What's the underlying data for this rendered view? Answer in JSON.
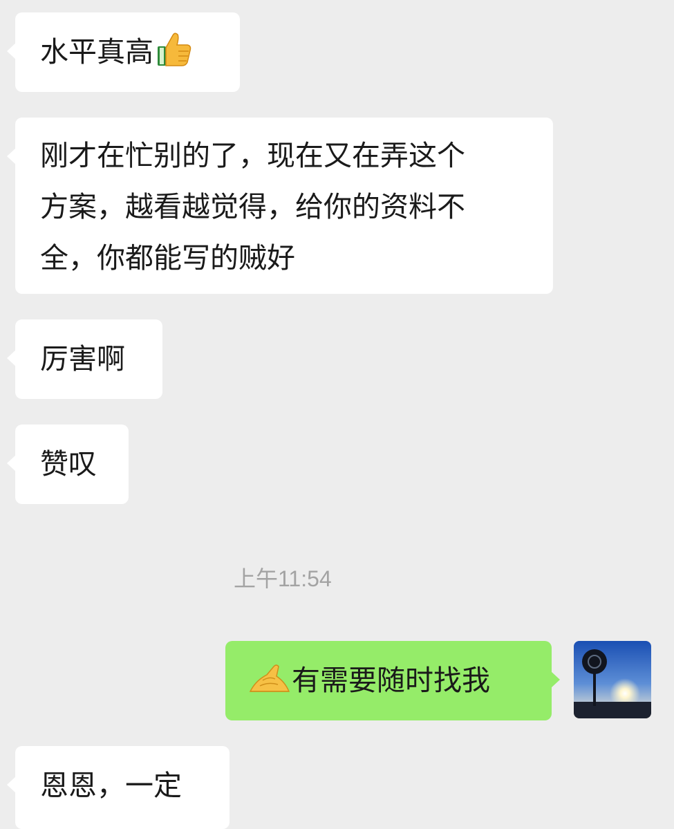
{
  "messages": {
    "m1": {
      "text": "水平真高",
      "emoji": "thumbs-up-icon"
    },
    "m2": {
      "lines": [
        "刚才在忙别的了，现在又在弄这个",
        "方案，越看越觉得，给你的资料不",
        "全，你都能写的贼好"
      ]
    },
    "m3": {
      "text": "厉害啊"
    },
    "m4": {
      "text": "赞叹"
    },
    "timestamp": "上午11:54",
    "m5": {
      "text": "有需要随时找我",
      "emoji": "pinching-hands-icon"
    },
    "m6": {
      "text": "恩恩，一定"
    }
  },
  "colors": {
    "background": "#ededed",
    "incoming_bubble": "#ffffff",
    "outgoing_bubble": "#95ec69",
    "timestamp_text": "#a3a3a3"
  }
}
